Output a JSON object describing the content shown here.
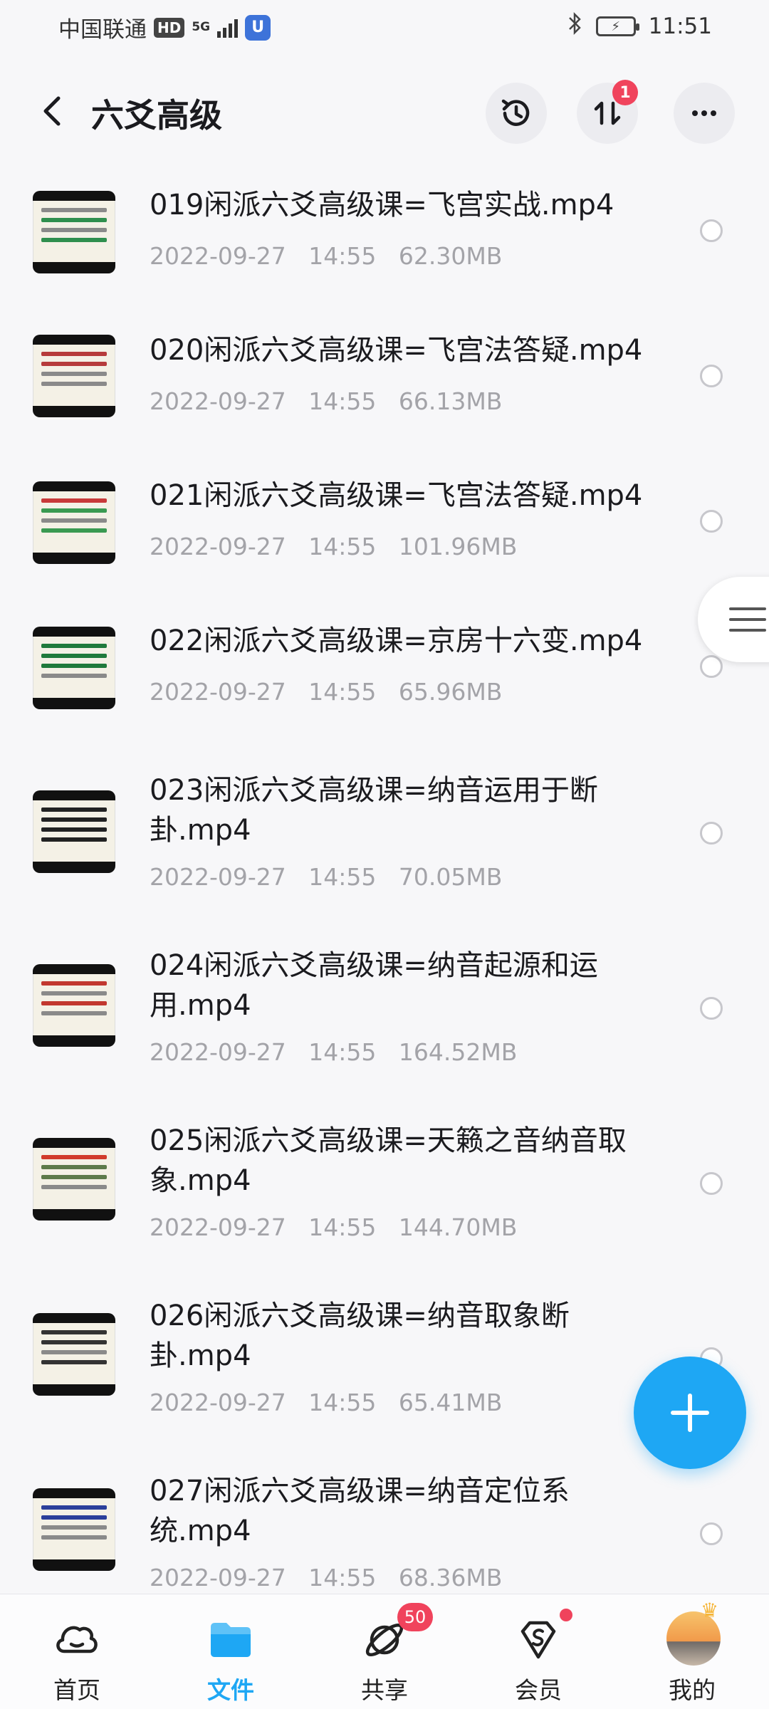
{
  "status_bar": {
    "carrier": "中国联通",
    "hd": "HD",
    "network": "5G",
    "vpn_icon": "shield-icon",
    "time": "11:51"
  },
  "header": {
    "title": "六爻高级",
    "transfer_badge": "1"
  },
  "files": [
    {
      "name": "019闲派六爻高级课=飞宫实战.mp4",
      "date": "2022-09-27",
      "time": "14:55",
      "size": "62.30MB"
    },
    {
      "name": "020闲派六爻高级课=飞宫法答疑.mp4",
      "date": "2022-09-27",
      "time": "14:55",
      "size": "66.13MB"
    },
    {
      "name": "021闲派六爻高级课=飞宫法答疑.mp4",
      "date": "2022-09-27",
      "time": "14:55",
      "size": "101.96MB"
    },
    {
      "name": "022闲派六爻高级课=京房十六变.mp4",
      "date": "2022-09-27",
      "time": "14:55",
      "size": "65.96MB"
    },
    {
      "name": "023闲派六爻高级课=纳音运用于断卦.mp4",
      "date": "2022-09-27",
      "time": "14:55",
      "size": "70.05MB"
    },
    {
      "name": "024闲派六爻高级课=纳音起源和运用.mp4",
      "date": "2022-09-27",
      "time": "14:55",
      "size": "164.52MB"
    },
    {
      "name": "025闲派六爻高级课=天籁之音纳音取象.mp4",
      "date": "2022-09-27",
      "time": "14:55",
      "size": "144.70MB"
    },
    {
      "name": "026闲派六爻高级课=纳音取象断卦.mp4",
      "date": "2022-09-27",
      "time": "14:55",
      "size": "65.41MB"
    },
    {
      "name": "027闲派六爻高级课=纳音定位系统.mp4",
      "date": "2022-09-27",
      "time": "14:55",
      "size": "68.36MB"
    }
  ],
  "bottom_nav": {
    "home": "首页",
    "files": "文件",
    "share": "共享",
    "share_badge": "50",
    "vip": "会员",
    "mine": "我的"
  },
  "colors": {
    "accent": "#1ea7f4",
    "badge": "#f0435c",
    "meta_text": "#a3a3a8"
  }
}
